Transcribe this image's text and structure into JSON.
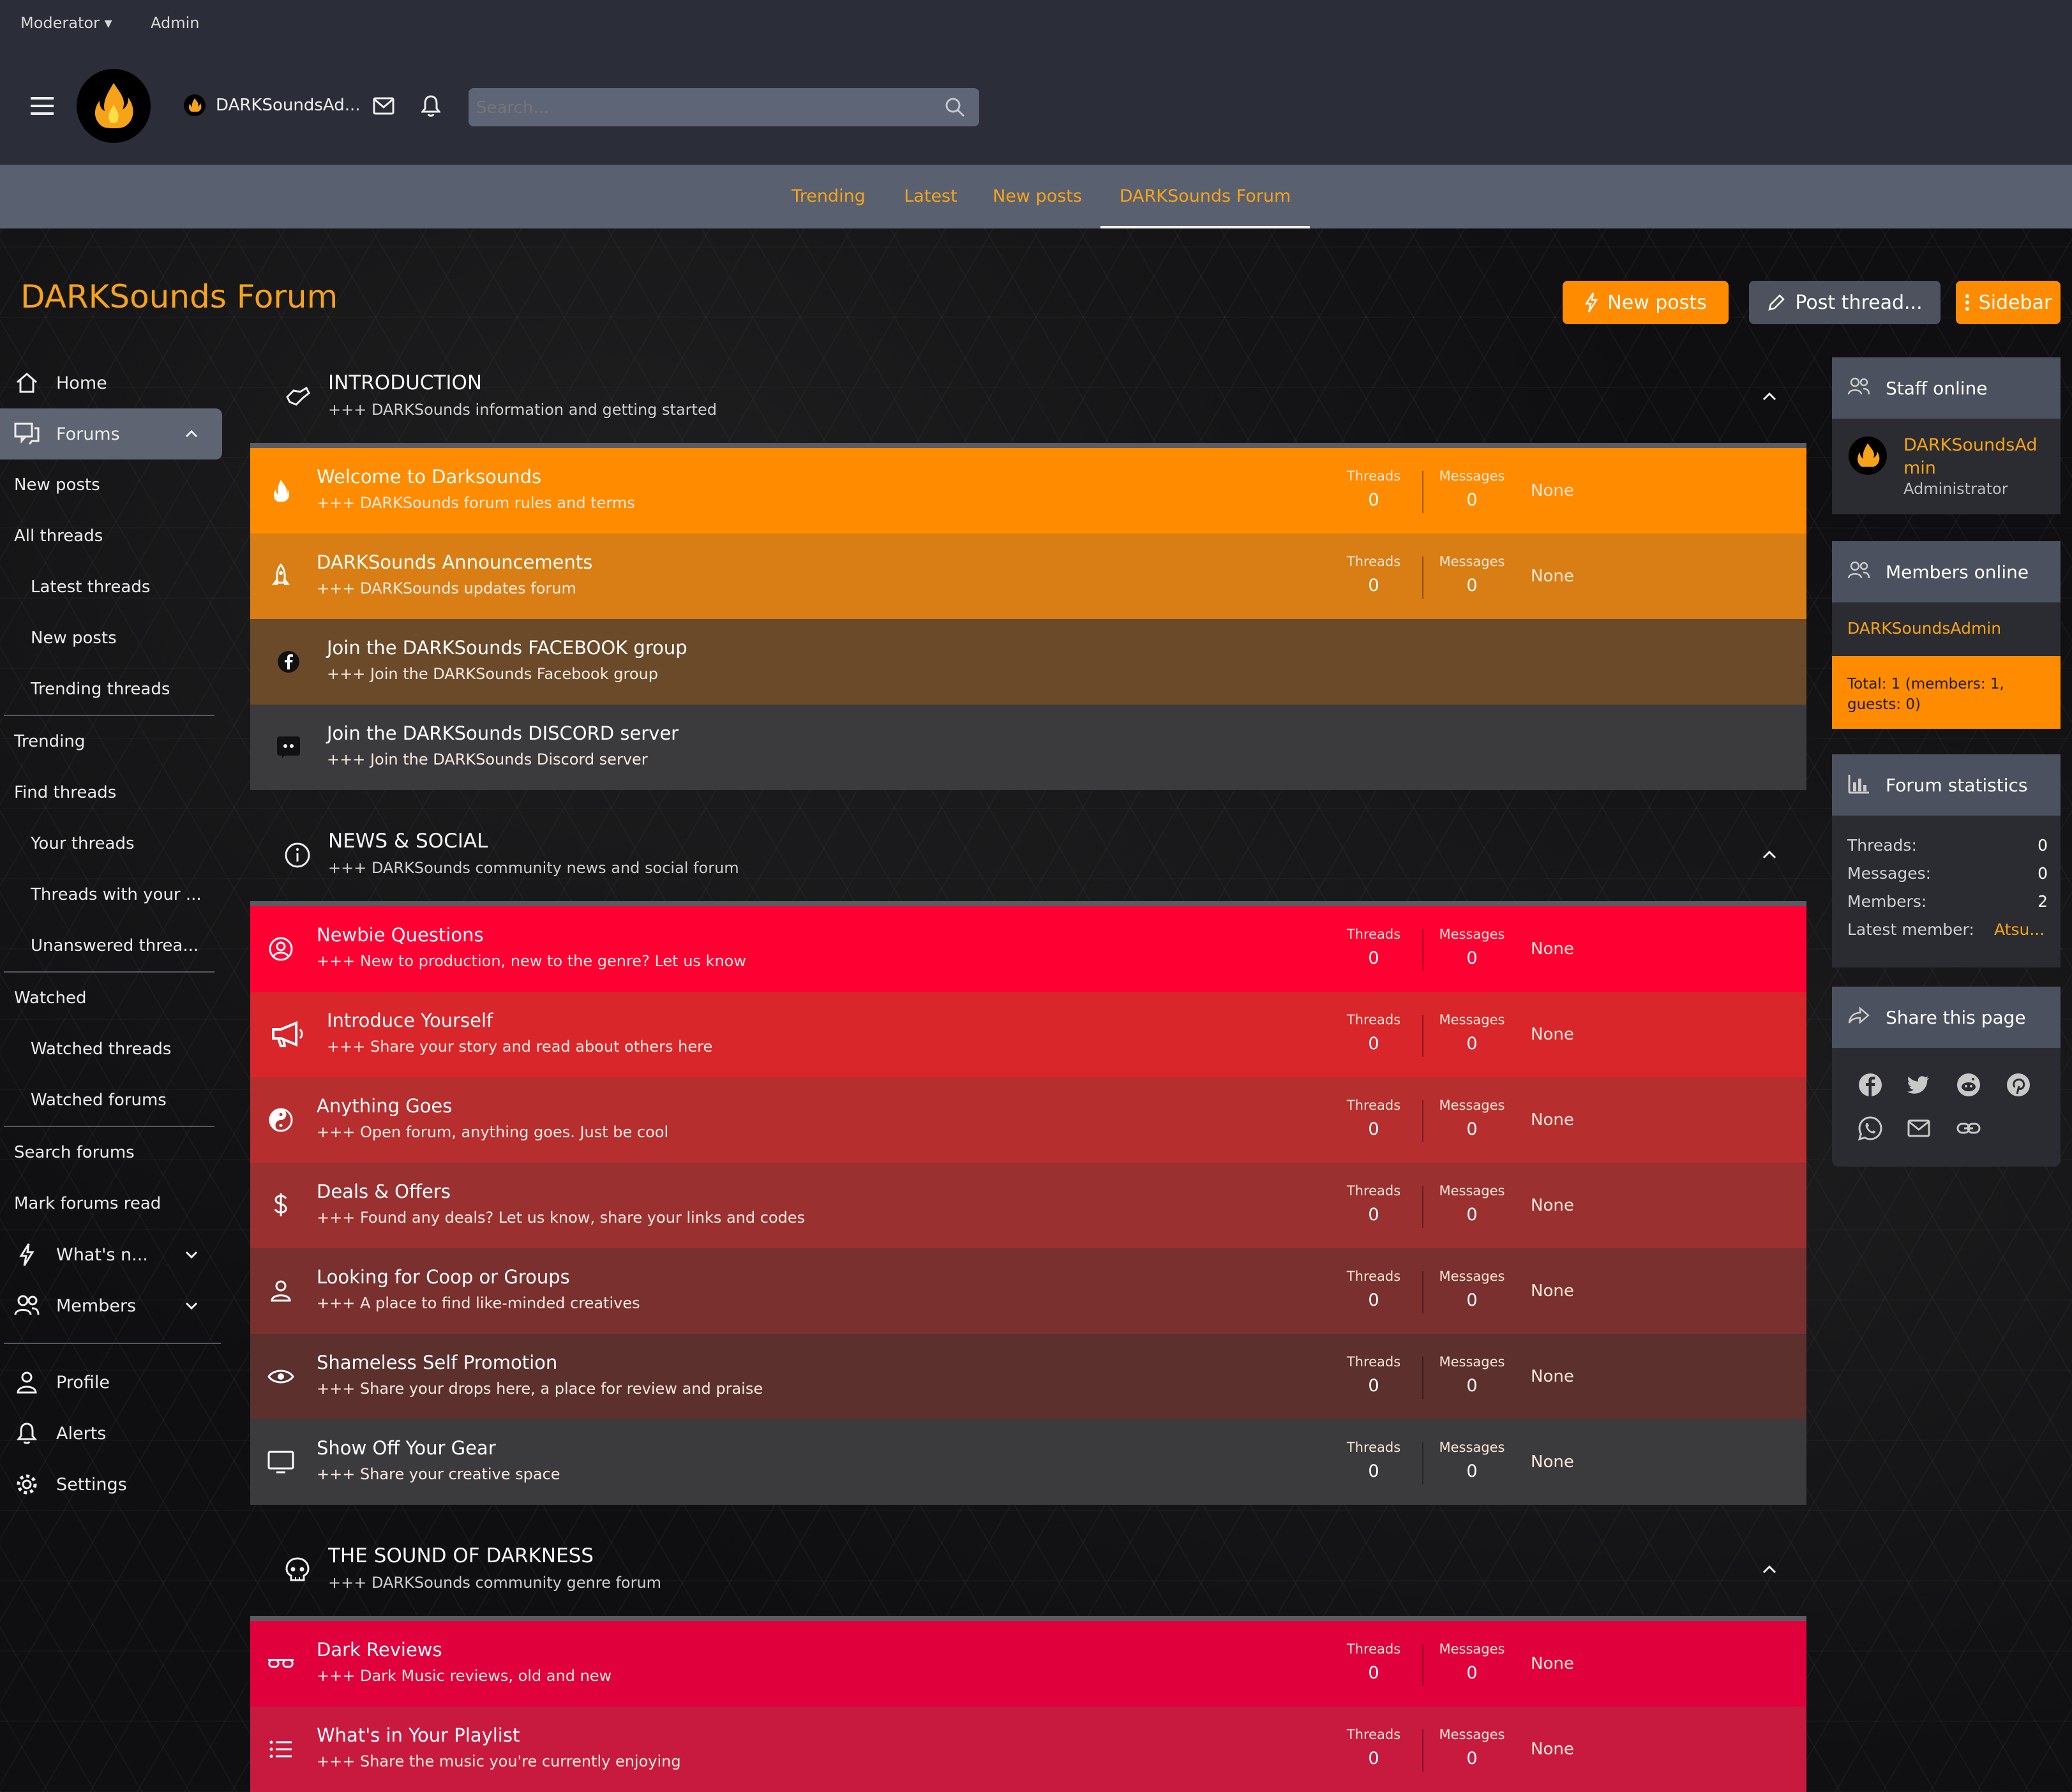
{
  "staff_bar": {
    "moderator": "Moderator",
    "admin": "Admin"
  },
  "header": {
    "username": "DARKSoundsAd...",
    "search_placeholder": "Search..."
  },
  "nav_tabs": [
    "Trending",
    "Latest",
    "New posts",
    "DARKSounds Forum"
  ],
  "page": {
    "title": "DARKSounds Forum",
    "btn_new_posts": "New posts",
    "btn_post_thread": "Post thread...",
    "btn_sidebar": "Sidebar"
  },
  "sidebar_nav": {
    "home": "Home",
    "forums": "Forums",
    "new_posts": "New posts",
    "all_threads": "All threads",
    "latest_threads": "Latest threads",
    "new_posts_sub": "New posts",
    "trending_threads": "Trending threads",
    "trending": "Trending",
    "find_threads": "Find threads",
    "your_threads": "Your threads",
    "threads_with_your": "Threads with your ...",
    "unanswered": "Unanswered threa...",
    "watched": "Watched",
    "watched_threads": "Watched threads",
    "watched_forums": "Watched forums",
    "search_forums": "Search forums",
    "mark_read": "Mark forums read",
    "whats_new": "What's n...",
    "members": "Members",
    "profile": "Profile",
    "alerts": "Alerts",
    "settings": "Settings"
  },
  "stat_labels": {
    "threads": "Threads",
    "messages": "Messages",
    "last_none": "None"
  },
  "categories": [
    {
      "title": "INTRODUCTION",
      "desc": "+++ DARKSounds information and getting started",
      "forums": [
        {
          "title": "Welcome to Darksounds",
          "desc": "+++ DARKSounds forum rules and terms",
          "threads": "0",
          "messages": "0",
          "color": "#ff8c00"
        },
        {
          "title": "DARKSounds Announcements",
          "desc": "+++ DARKSounds updates forum",
          "threads": "0",
          "messages": "0",
          "color": "#d97e14"
        },
        {
          "title": "Join the DARKSounds FACEBOOK group",
          "desc": "+++ Join the DARKSounds Facebook group",
          "color": "#6b4a2a"
        },
        {
          "title": "Join the DARKSounds DISCORD server",
          "desc": "+++ Join the DARKSounds Discord server",
          "color": "#3b3b3e"
        }
      ]
    },
    {
      "title": "NEWS & SOCIAL",
      "desc": "+++ DARKSounds community news and social forum",
      "forums": [
        {
          "title": "Newbie Questions",
          "desc": "+++ New to production, new to the genre? Let us know",
          "threads": "0",
          "messages": "0",
          "color": "#ff0033"
        },
        {
          "title": "Introduce Yourself",
          "desc": "+++ Share your story and read about others here",
          "threads": "0",
          "messages": "0",
          "color": "#d9262b"
        },
        {
          "title": "Anything Goes",
          "desc": "+++ Open forum, anything goes. Just be cool",
          "threads": "0",
          "messages": "0",
          "color": "#b72e2e"
        },
        {
          "title": "Deals & Offers",
          "desc": "+++ Found any deals? Let us know, share your links and codes",
          "threads": "0",
          "messages": "0",
          "color": "#9a3030"
        },
        {
          "title": "Looking for Coop or Groups",
          "desc": "+++ A place to find like-minded creatives",
          "threads": "0",
          "messages": "0",
          "color": "#7a302e"
        },
        {
          "title": "Shameless Self Promotion",
          "desc": "+++ Share your drops here, a place for review and praise",
          "threads": "0",
          "messages": "0",
          "color": "#5b302d"
        },
        {
          "title": "Show Off Your Gear",
          "desc": "+++ Share your creative space",
          "threads": "0",
          "messages": "0",
          "color": "#3b3b3e"
        }
      ]
    },
    {
      "title": "THE SOUND OF DARKNESS",
      "desc": "+++ DARKSounds community genre forum",
      "forums": [
        {
          "title": "Dark Reviews",
          "desc": "+++ Dark Music reviews, old and new",
          "threads": "0",
          "messages": "0",
          "color": "#e0003c"
        },
        {
          "title": "What's in Your Playlist",
          "desc": "+++ Share the music you're currently enjoying",
          "threads": "0",
          "messages": "0",
          "color": "#c81a3e"
        }
      ]
    }
  ],
  "right_sidebar": {
    "staff_online": {
      "title": "Staff online",
      "user_line1": "DARKSoundsAd",
      "user_line2": "min",
      "role": "Administrator"
    },
    "members_online": {
      "title": "Members online",
      "user": "DARKSoundsAdmin",
      "total_line1": "Total: 1 (members: 1,",
      "total_line2": "guests: 0)"
    },
    "forum_stats": {
      "title": "Forum statistics",
      "threads_label": "Threads:",
      "threads": "0",
      "messages_label": "Messages:",
      "messages": "0",
      "members_label": "Members:",
      "members": "2",
      "latest_label": "Latest member:",
      "latest": "Atsu..."
    },
    "share": {
      "title": "Share this page"
    }
  },
  "colors": {
    "accent": "#f7a31a",
    "header_bg": "#2b2e38",
    "nav_bg": "#596170"
  }
}
